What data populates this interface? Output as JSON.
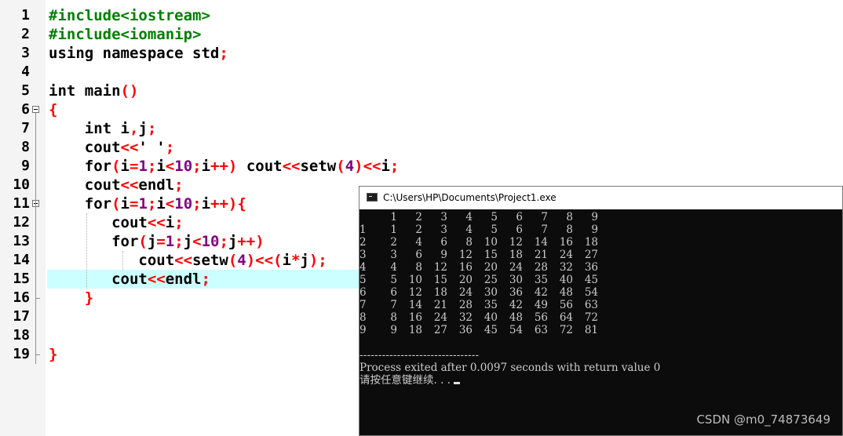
{
  "editor": {
    "lines": [
      [
        {
          "t": "#include<iostream>",
          "c": "#008000"
        }
      ],
      [
        {
          "t": "#include<iomanip>",
          "c": "#008000"
        }
      ],
      [
        {
          "t": "using namespace std",
          "c": "#000000"
        },
        {
          "t": ";",
          "c": "#ff0000"
        }
      ],
      [],
      [
        {
          "t": "int main",
          "c": "#000000"
        },
        {
          "t": "()",
          "c": "#ff0000"
        }
      ],
      [
        {
          "t": "{",
          "c": "#ff0000"
        }
      ],
      [
        {
          "t": "    int i",
          "c": "#000000"
        },
        {
          "t": ",",
          "c": "#ff0000"
        },
        {
          "t": "j",
          "c": "#000000"
        },
        {
          "t": ";",
          "c": "#ff0000"
        }
      ],
      [
        {
          "t": "    cout",
          "c": "#000000"
        },
        {
          "t": "<<",
          "c": "#ff0000"
        },
        {
          "t": "' '",
          "c": "#000000"
        },
        {
          "t": ";",
          "c": "#ff0000"
        }
      ],
      [
        {
          "t": "    for",
          "c": "#000000"
        },
        {
          "t": "(",
          "c": "#ff0000"
        },
        {
          "t": "i",
          "c": "#000000"
        },
        {
          "t": "=",
          "c": "#ff0000"
        },
        {
          "t": "1",
          "c": "#800080"
        },
        {
          "t": ";",
          "c": "#ff0000"
        },
        {
          "t": "i",
          "c": "#000000"
        },
        {
          "t": "<",
          "c": "#ff0000"
        },
        {
          "t": "10",
          "c": "#800080"
        },
        {
          "t": ";",
          "c": "#ff0000"
        },
        {
          "t": "i",
          "c": "#000000"
        },
        {
          "t": "++)",
          "c": "#ff0000"
        },
        {
          "t": " cout",
          "c": "#000000"
        },
        {
          "t": "<<",
          "c": "#ff0000"
        },
        {
          "t": "setw",
          "c": "#000000"
        },
        {
          "t": "(",
          "c": "#ff0000"
        },
        {
          "t": "4",
          "c": "#800080"
        },
        {
          "t": ")<<",
          "c": "#ff0000"
        },
        {
          "t": "i",
          "c": "#000000"
        },
        {
          "t": ";",
          "c": "#ff0000"
        }
      ],
      [
        {
          "t": "    cout",
          "c": "#000000"
        },
        {
          "t": "<<",
          "c": "#ff0000"
        },
        {
          "t": "endl",
          "c": "#000000"
        },
        {
          "t": ";",
          "c": "#ff0000"
        }
      ],
      [
        {
          "t": "    for",
          "c": "#000000"
        },
        {
          "t": "(",
          "c": "#ff0000"
        },
        {
          "t": "i",
          "c": "#000000"
        },
        {
          "t": "=",
          "c": "#ff0000"
        },
        {
          "t": "1",
          "c": "#800080"
        },
        {
          "t": ";",
          "c": "#ff0000"
        },
        {
          "t": "i",
          "c": "#000000"
        },
        {
          "t": "<",
          "c": "#ff0000"
        },
        {
          "t": "10",
          "c": "#800080"
        },
        {
          "t": ";",
          "c": "#ff0000"
        },
        {
          "t": "i",
          "c": "#000000"
        },
        {
          "t": "++){",
          "c": "#ff0000"
        }
      ],
      [
        {
          "t": "       cout",
          "c": "#000000"
        },
        {
          "t": "<<",
          "c": "#ff0000"
        },
        {
          "t": "i",
          "c": "#000000"
        },
        {
          "t": ";",
          "c": "#ff0000"
        }
      ],
      [
        {
          "t": "       for",
          "c": "#000000"
        },
        {
          "t": "(",
          "c": "#ff0000"
        },
        {
          "t": "j",
          "c": "#000000"
        },
        {
          "t": "=",
          "c": "#ff0000"
        },
        {
          "t": "1",
          "c": "#800080"
        },
        {
          "t": ";",
          "c": "#ff0000"
        },
        {
          "t": "j",
          "c": "#000000"
        },
        {
          "t": "<",
          "c": "#ff0000"
        },
        {
          "t": "10",
          "c": "#800080"
        },
        {
          "t": ";",
          "c": "#ff0000"
        },
        {
          "t": "j",
          "c": "#000000"
        },
        {
          "t": "++)",
          "c": "#ff0000"
        }
      ],
      [
        {
          "t": "          cout",
          "c": "#000000"
        },
        {
          "t": "<<",
          "c": "#ff0000"
        },
        {
          "t": "setw",
          "c": "#000000"
        },
        {
          "t": "(",
          "c": "#ff0000"
        },
        {
          "t": "4",
          "c": "#800080"
        },
        {
          "t": ")<<(",
          "c": "#ff0000"
        },
        {
          "t": "i",
          "c": "#000000"
        },
        {
          "t": "*",
          "c": "#ff0000"
        },
        {
          "t": "j",
          "c": "#000000"
        },
        {
          "t": ");",
          "c": "#ff0000"
        }
      ],
      [
        {
          "t": "       cout",
          "c": "#000000"
        },
        {
          "t": "<<",
          "c": "#ff0000"
        },
        {
          "t": "endl",
          "c": "#000000"
        },
        {
          "t": ";",
          "c": "#ff0000"
        }
      ],
      [
        {
          "t": "    }",
          "c": "#ff0000"
        }
      ],
      [],
      [],
      [
        {
          "t": "}",
          "c": "#ff0000"
        }
      ]
    ],
    "line_numbers": [
      "1",
      "2",
      "3",
      "4",
      "5",
      "6",
      "7",
      "8",
      "9",
      "10",
      "11",
      "12",
      "13",
      "14",
      "15",
      "16",
      "17",
      "18",
      "19"
    ],
    "highlight_line": 15,
    "colors": {
      "keyword": "#000000",
      "symbol": "#ff0000",
      "number": "#800080",
      "preprocessor": "#008000",
      "highlight": "#ccffff"
    }
  },
  "console": {
    "title": "C:\\Users\\HP\\Documents\\Project1.exe",
    "header_row": [
      "1",
      "2",
      "3",
      "4",
      "5",
      "6",
      "7",
      "8",
      "9"
    ],
    "rows": [
      [
        "1",
        "1",
        "2",
        "3",
        "4",
        "5",
        "6",
        "7",
        "8",
        "9"
      ],
      [
        "2",
        "2",
        "4",
        "6",
        "8",
        "10",
        "12",
        "14",
        "16",
        "18"
      ],
      [
        "3",
        "3",
        "6",
        "9",
        "12",
        "15",
        "18",
        "21",
        "24",
        "27"
      ],
      [
        "4",
        "4",
        "8",
        "12",
        "16",
        "20",
        "24",
        "28",
        "32",
        "36"
      ],
      [
        "5",
        "5",
        "10",
        "15",
        "20",
        "25",
        "30",
        "35",
        "40",
        "45"
      ],
      [
        "6",
        "6",
        "12",
        "18",
        "24",
        "30",
        "36",
        "42",
        "48",
        "54"
      ],
      [
        "7",
        "7",
        "14",
        "21",
        "28",
        "35",
        "42",
        "49",
        "56",
        "63"
      ],
      [
        "8",
        "8",
        "16",
        "24",
        "32",
        "40",
        "48",
        "56",
        "64",
        "72"
      ],
      [
        "9",
        "9",
        "18",
        "27",
        "36",
        "45",
        "54",
        "63",
        "72",
        "81"
      ]
    ],
    "separator": "--------------------------------",
    "process_msg": "Process exited after 0.0097 seconds with return value 0",
    "prompt": "请按任意键继续. . . "
  },
  "watermark": "CSDN @m0_74873649"
}
